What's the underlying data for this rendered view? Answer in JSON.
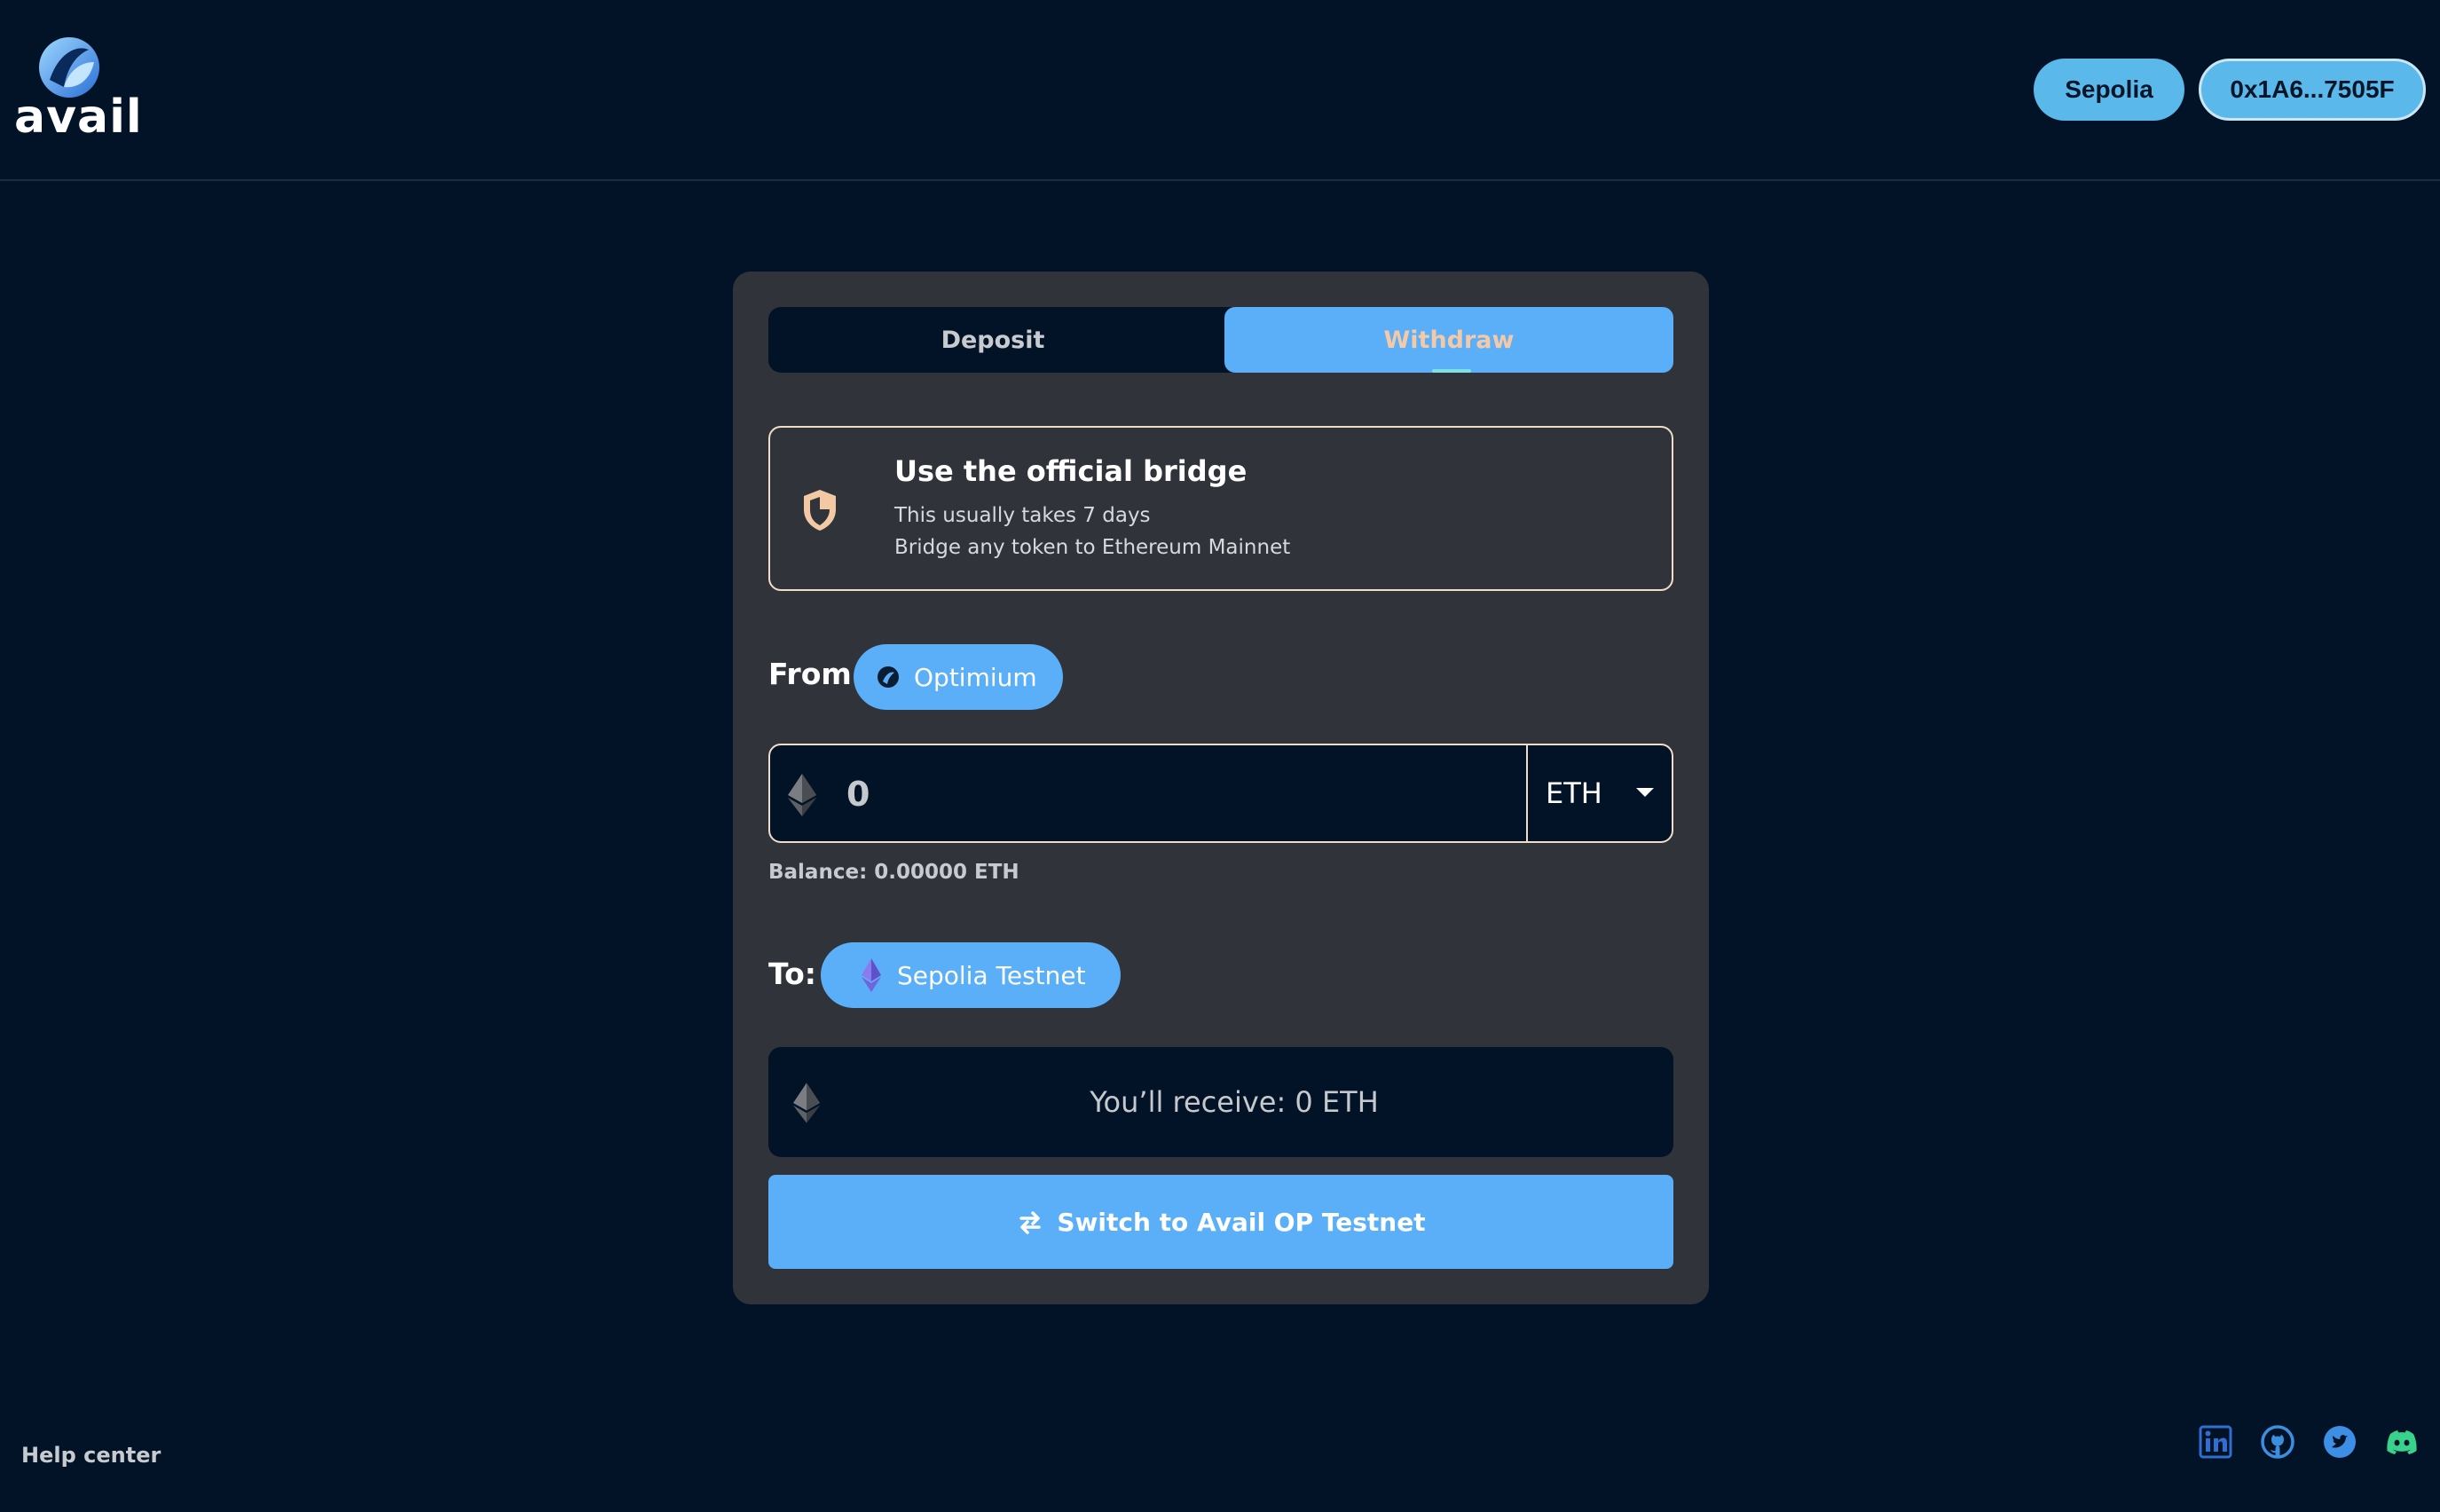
{
  "header": {
    "logo_text": "avail",
    "network_label": "Sepolia",
    "wallet_address": "0x1A6...7505F"
  },
  "tabs": [
    {
      "label": "Deposit",
      "active": false
    },
    {
      "label": "Withdraw",
      "active": true
    }
  ],
  "info": {
    "title": "Use the official bridge",
    "line1": "This usually takes 7 days",
    "line2": "Bridge any token to Ethereum Mainnet"
  },
  "from": {
    "label": "From",
    "chain": "Optimium"
  },
  "amount": {
    "placeholder": "0",
    "token": "ETH",
    "balance": "Balance: 0.00000 ETH"
  },
  "to": {
    "label": "To:",
    "chain": "Sepolia Testnet"
  },
  "receive": {
    "text": "You’ll receive: 0 ETH"
  },
  "action": {
    "label": "Switch to Avail OP Testnet"
  },
  "footer": {
    "help_label": "Help center",
    "socials": [
      "linkedin-icon",
      "github-icon",
      "twitter-icon",
      "discord-icon"
    ]
  },
  "colors": {
    "background": "#031327",
    "card": "#30343a",
    "accent": "#5aaff8",
    "border": "#f0ddc8"
  }
}
